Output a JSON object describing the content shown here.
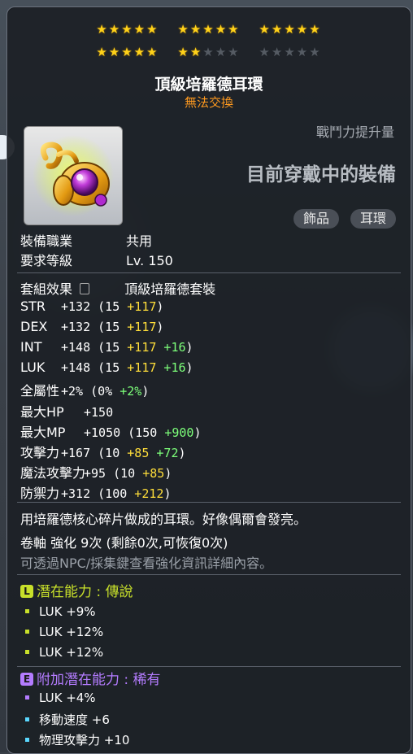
{
  "stars": {
    "row1": [
      5,
      5,
      5
    ],
    "row2": [
      5,
      2,
      0
    ],
    "total_filled": 22,
    "max": 30
  },
  "item": {
    "name": "頂級培羅德耳環",
    "trade_status": "無法交換",
    "power_label": "戰鬥力提升量",
    "equip_status": "目前穿戴中的裝備",
    "tags": [
      "飾品",
      "耳環"
    ],
    "icon": "earring-icon"
  },
  "requirements": [
    {
      "label": "裝備職業",
      "value": "共用"
    },
    {
      "label": "要求等級",
      "value": "Lv. 150"
    }
  ],
  "set_effect": {
    "label": "套組效果",
    "value": "頂級培羅德套裝",
    "icon": "lock-icon"
  },
  "stats": [
    {
      "name": "STR",
      "main": "+132",
      "base": "15",
      "yellow": "+117",
      "green": ""
    },
    {
      "name": "DEX",
      "main": "+132",
      "base": "15",
      "yellow": "+117",
      "green": ""
    },
    {
      "name": "INT",
      "main": "+148",
      "base": "15",
      "yellow": "+117",
      "green": "+16"
    },
    {
      "name": "LUK",
      "main": "+148",
      "base": "15",
      "yellow": "+117",
      "green": "+16"
    },
    {
      "name": "全屬性",
      "main": "+2%",
      "base": "0%",
      "yellow": "",
      "green": "+2%"
    },
    {
      "name": "最大HP",
      "main": "+150",
      "base": "",
      "yellow": "",
      "green": ""
    },
    {
      "name": "最大MP",
      "main": "+1050",
      "base": "150",
      "yellow": "",
      "green": "+900"
    },
    {
      "name": "攻擊力",
      "main": "+167",
      "base": "10",
      "yellow": "+85",
      "green": "+72"
    },
    {
      "name": "魔法攻擊力",
      "main": "+95",
      "base": "10",
      "yellow": "+85",
      "green": ""
    },
    {
      "name": "防禦力",
      "main": "+312",
      "base": "100",
      "yellow": "+212",
      "green": ""
    }
  ],
  "description": "用培羅德核心碎片做成的耳環。好像偶爾會發亮。",
  "scroll_info": "卷軸 強化 9次 (剩餘0次,可恢復0次)",
  "hint": "可透過NPC/採集鍵查看強化資訊詳細內容。",
  "potential": {
    "badge": "L",
    "title": "潛在能力 : 傳說",
    "color": "#c8e02a",
    "lines": [
      "LUK +9%",
      "LUK +12%",
      "LUK +12%"
    ]
  },
  "bonus_potential": {
    "badge": "E",
    "title": "附加潛在能力 : 稀有",
    "color": "#b47cff",
    "lines": [
      {
        "text": "LUK +4%",
        "color": "#b47cff"
      },
      {
        "text": "移動速度 +6",
        "color": "#5ad8ff"
      },
      {
        "text": "物理攻擊力 +10",
        "color": "#5ad8ff"
      }
    ]
  }
}
